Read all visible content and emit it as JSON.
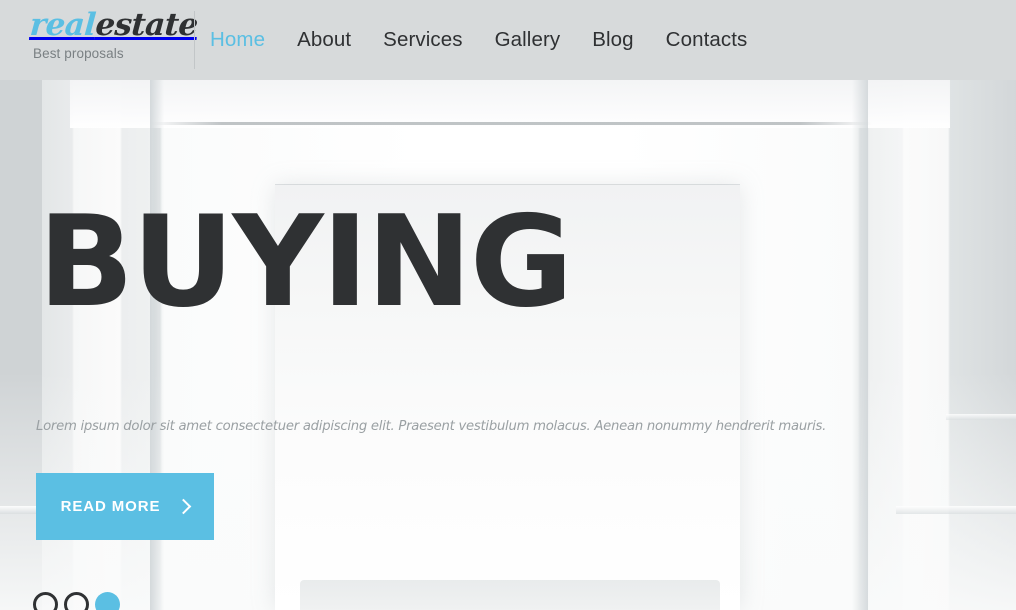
{
  "colors": {
    "accent": "#5bbfe3",
    "dark": "#2f3133",
    "header_bg": "#d7dadb",
    "muted_text": "#9aa0a3",
    "tagline_text": "#7a8083"
  },
  "header": {
    "brand": {
      "part_blue": "real",
      "part_dark": "estate",
      "tagline": "Best proposals"
    },
    "nav": [
      {
        "label": "Home",
        "active": true
      },
      {
        "label": "About",
        "active": false
      },
      {
        "label": "Services",
        "active": false
      },
      {
        "label": "Gallery",
        "active": false
      },
      {
        "label": "Blog",
        "active": false
      },
      {
        "label": "Contacts",
        "active": false
      }
    ]
  },
  "hero": {
    "title": "BUYING",
    "subtitle": "Lorem ipsum dolor sit amet consectetuer adipiscing elit. Praesent vestibulum molacus. Aenean nonummy hendrerit mauris.",
    "cta": {
      "label": "READ MORE",
      "icon": "chevron-right-icon"
    },
    "slider": {
      "total": 3,
      "active_index": 3,
      "dots": [
        {
          "label": "1",
          "active": false
        },
        {
          "label": "2",
          "active": false
        },
        {
          "label": "3",
          "active": true
        }
      ]
    }
  }
}
